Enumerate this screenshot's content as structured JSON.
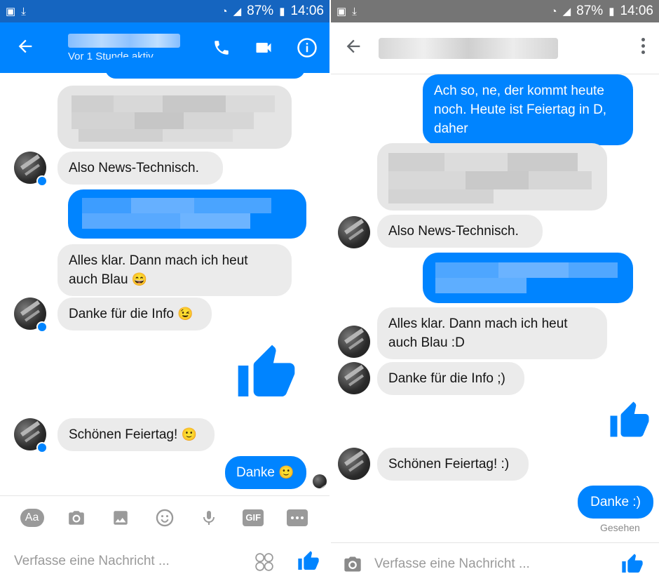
{
  "status_bar": {
    "battery": "87%",
    "time": "14:06"
  },
  "left": {
    "header": {
      "subtitle": "Vor 1 Stunde aktiv"
    },
    "messages": {
      "m1": "Also News-Technisch.",
      "m2": "Alles klar. Dann mach ich heut auch Blau",
      "m3": "Danke für die Info",
      "m4": "Schönen Feiertag!",
      "m5": "Danke"
    },
    "toolbar": {
      "aa_label": "Aa",
      "gif_label": "GIF"
    },
    "composer": {
      "placeholder": "Verfasse eine Nachricht ..."
    }
  },
  "right": {
    "messages": {
      "r1": "Ach so, ne, der kommt heute noch. Heute ist Feiertag in D, daher",
      "r2": "Also News-Technisch.",
      "r3": "Alles klar. Dann mach ich heut auch Blau :D",
      "r4": "Danke für die Info ;)",
      "r5": "Schönen Feiertag! :)",
      "r6": "Danke :)"
    },
    "seen": "Gesehen",
    "composer": {
      "placeholder": "Verfasse eine Nachricht ..."
    }
  },
  "icons": {
    "back": "arrow-left-icon",
    "phone": "phone-icon",
    "video": "video-camera-icon",
    "info": "info-icon",
    "camera": "camera-icon",
    "image": "image-icon",
    "emoji": "smiley-icon",
    "mic": "microphone-icon",
    "more": "more-icon",
    "like": "thumbs-up-icon"
  },
  "colors": {
    "messenger_blue": "#0084ff",
    "incoming_bubble": "#ebebeb",
    "status_bar_left": "#1565c0",
    "status_bar_right": "#757575"
  }
}
